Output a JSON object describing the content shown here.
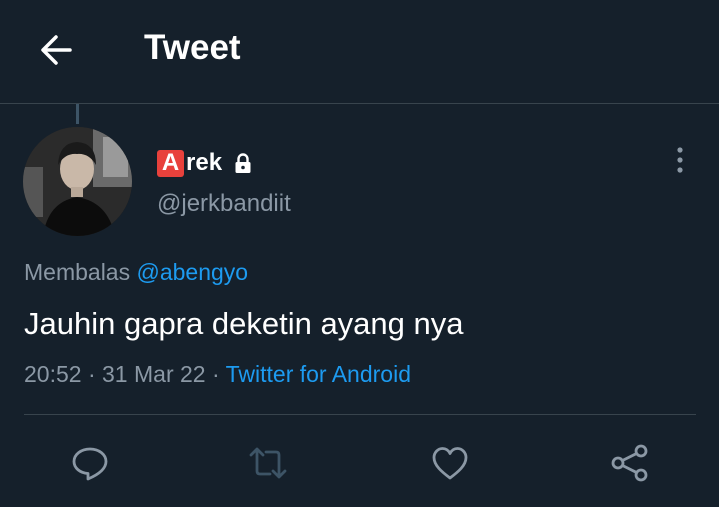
{
  "header": {
    "title": "Tweet",
    "back_icon": "arrow-left-icon"
  },
  "tweet": {
    "author": {
      "badge_letter": "A",
      "display_name_rest": "rek",
      "handle": "@jerkbandiit",
      "locked": true
    },
    "reply_prefix": "Membalas",
    "reply_to": "@abengyo",
    "text": "Jauhin gapra deketin ayang nya",
    "time": "20:52",
    "separator": "·",
    "date": "31 Mar 22",
    "source": "Twitter for Android"
  },
  "actions": [
    {
      "icon": "reply-icon"
    },
    {
      "icon": "retweet-icon"
    },
    {
      "icon": "like-icon"
    },
    {
      "icon": "share-icon"
    }
  ],
  "colors": {
    "background": "#15202b",
    "accent": "#1d9bf0",
    "muted": "#8b98a5",
    "badge": "#e8413c"
  }
}
